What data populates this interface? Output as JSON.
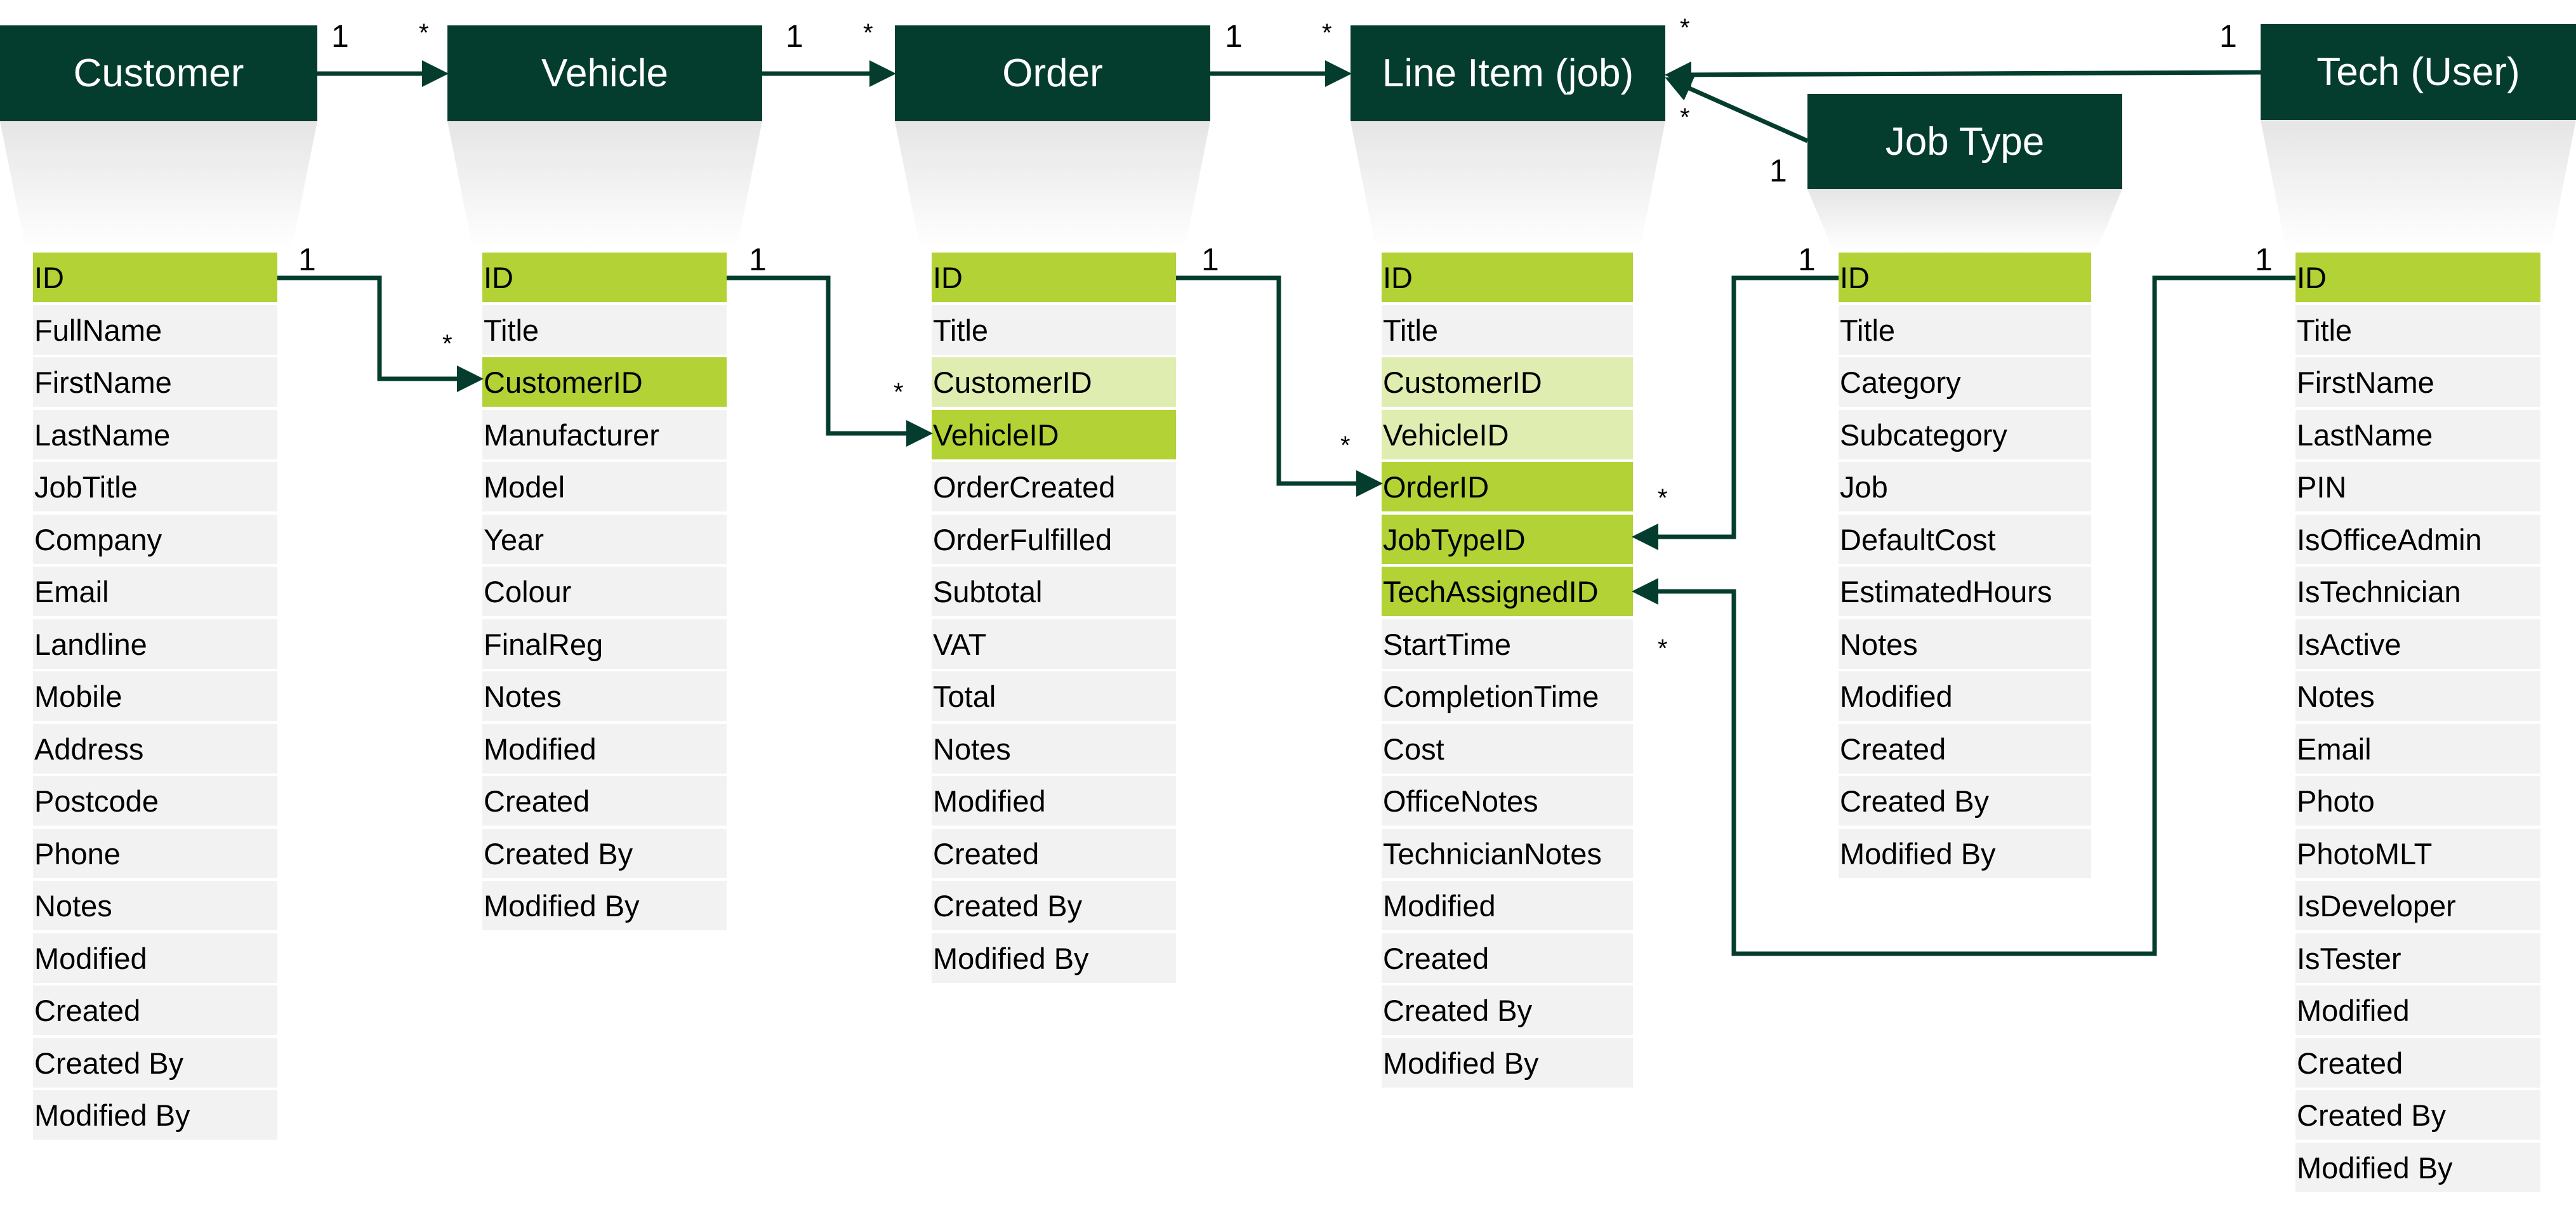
{
  "diagram": {
    "type": "entity-relationship",
    "colors": {
      "entity_header": "#043D2E",
      "primary_key": "#B2D235",
      "foreign_key_linked": "#B2D235",
      "foreign_key_unlinked": "#E0EDB0",
      "field": "#F2F2F2",
      "connector": "#043D2E"
    },
    "entities": [
      {
        "name": "Customer",
        "fields": [
          {
            "name": "ID",
            "role": "pk"
          },
          {
            "name": "FullName"
          },
          {
            "name": "FirstName"
          },
          {
            "name": "LastName"
          },
          {
            "name": "JobTitle"
          },
          {
            "name": "Company"
          },
          {
            "name": "Email"
          },
          {
            "name": "Landline"
          },
          {
            "name": "Mobile"
          },
          {
            "name": "Address"
          },
          {
            "name": "Postcode"
          },
          {
            "name": "Phone"
          },
          {
            "name": "Notes"
          },
          {
            "name": "Modified"
          },
          {
            "name": "Created"
          },
          {
            "name": "Created By"
          },
          {
            "name": "Modified By"
          }
        ]
      },
      {
        "name": "Vehicle",
        "fields": [
          {
            "name": "ID",
            "role": "pk"
          },
          {
            "name": "Title"
          },
          {
            "name": "CustomerID",
            "role": "fk"
          },
          {
            "name": "Manufacturer"
          },
          {
            "name": "Model"
          },
          {
            "name": "Year"
          },
          {
            "name": "Colour"
          },
          {
            "name": "FinalReg"
          },
          {
            "name": "Notes"
          },
          {
            "name": "Modified"
          },
          {
            "name": "Created"
          },
          {
            "name": "Created By"
          },
          {
            "name": "Modified By"
          }
        ]
      },
      {
        "name": "Order",
        "fields": [
          {
            "name": "ID",
            "role": "pk"
          },
          {
            "name": "Title"
          },
          {
            "name": "CustomerID",
            "role": "ref"
          },
          {
            "name": "VehicleID",
            "role": "fk"
          },
          {
            "name": "OrderCreated"
          },
          {
            "name": "OrderFulfilled"
          },
          {
            "name": "Subtotal"
          },
          {
            "name": "VAT"
          },
          {
            "name": "Total"
          },
          {
            "name": "Notes"
          },
          {
            "name": "Modified"
          },
          {
            "name": "Created"
          },
          {
            "name": "Created By"
          },
          {
            "name": "Modified By"
          }
        ]
      },
      {
        "name": "Line Item (job)",
        "fields": [
          {
            "name": "ID",
            "role": "pk"
          },
          {
            "name": "Title"
          },
          {
            "name": "CustomerID",
            "role": "ref"
          },
          {
            "name": "VehicleID",
            "role": "ref"
          },
          {
            "name": "OrderID",
            "role": "fk"
          },
          {
            "name": "JobTypeID",
            "role": "fk"
          },
          {
            "name": "TechAssignedID",
            "role": "fk"
          },
          {
            "name": "StartTime"
          },
          {
            "name": "CompletionTime"
          },
          {
            "name": "Cost"
          },
          {
            "name": "OfficeNotes"
          },
          {
            "name": "TechnicianNotes"
          },
          {
            "name": "Modified"
          },
          {
            "name": "Created"
          },
          {
            "name": "Created By"
          },
          {
            "name": "Modified By"
          }
        ]
      },
      {
        "name": "Job Type",
        "fields": [
          {
            "name": "ID",
            "role": "pk"
          },
          {
            "name": "Title"
          },
          {
            "name": "Category"
          },
          {
            "name": "Subcategory"
          },
          {
            "name": "Job"
          },
          {
            "name": "DefaultCost"
          },
          {
            "name": "EstimatedHours"
          },
          {
            "name": "Notes"
          },
          {
            "name": "Modified"
          },
          {
            "name": "Created"
          },
          {
            "name": "Created By"
          },
          {
            "name": "Modified By"
          }
        ]
      },
      {
        "name": "Tech (User)",
        "fields": [
          {
            "name": "ID",
            "role": "pk"
          },
          {
            "name": "Title"
          },
          {
            "name": "FirstName"
          },
          {
            "name": "LastName"
          },
          {
            "name": "PIN"
          },
          {
            "name": "IsOfficeAdmin"
          },
          {
            "name": "IsTechnician"
          },
          {
            "name": "IsActive"
          },
          {
            "name": "Notes"
          },
          {
            "name": "Email"
          },
          {
            "name": "Photo"
          },
          {
            "name": "PhotoMLT"
          },
          {
            "name": "IsDeveloper"
          },
          {
            "name": "IsTester"
          },
          {
            "name": "Modified"
          },
          {
            "name": "Created"
          },
          {
            "name": "Created By"
          },
          {
            "name": "Modified By"
          }
        ]
      }
    ],
    "header_relationships": [
      {
        "from": "Customer",
        "to": "Vehicle",
        "from_card": "1",
        "to_card": "*"
      },
      {
        "from": "Vehicle",
        "to": "Order",
        "from_card": "1",
        "to_card": "*"
      },
      {
        "from": "Order",
        "to": "Line Item (job)",
        "from_card": "1",
        "to_card": "*"
      },
      {
        "from": "Tech (User)",
        "to": "Line Item (job)",
        "from_card": "1",
        "to_card": "*"
      },
      {
        "from": "Job Type",
        "to": "Line Item (job)",
        "from_card": "1",
        "to_card": "*"
      }
    ],
    "field_relationships": [
      {
        "from": "Customer.ID",
        "to": "Vehicle.CustomerID",
        "from_card": "1",
        "to_card": "*"
      },
      {
        "from": "Vehicle.ID",
        "to": "Order.VehicleID",
        "from_card": "1",
        "to_card": "*"
      },
      {
        "from": "Order.ID",
        "to": "Line Item (job).OrderID",
        "from_card": "1",
        "to_card": "*"
      },
      {
        "from": "Job Type.ID",
        "to": "Line Item (job).JobTypeID",
        "from_card": "1",
        "to_card": "*"
      },
      {
        "from": "Tech (User).ID",
        "to": "Line Item (job).TechAssignedID",
        "from_card": "1",
        "to_card": "*"
      }
    ]
  }
}
